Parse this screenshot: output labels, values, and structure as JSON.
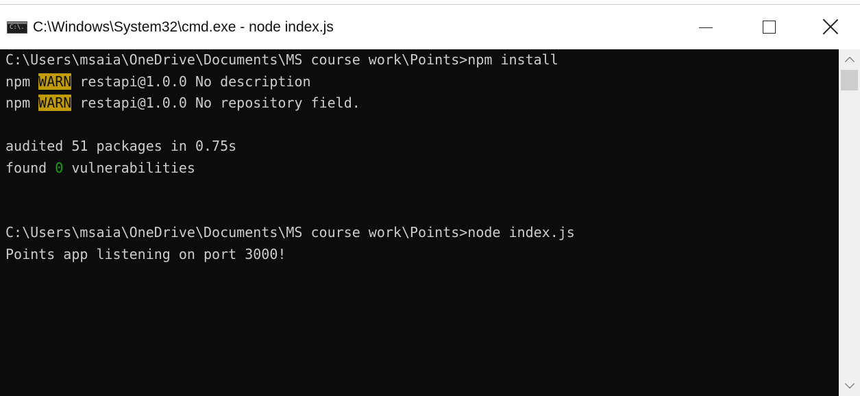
{
  "window": {
    "title": "C:\\Windows\\System32\\cmd.exe - node  index.js",
    "icon_text": "C:\\."
  },
  "controls": {
    "minimize": "minimize-icon",
    "maximize": "maximize-icon",
    "close": "close-icon"
  },
  "console": {
    "lines": [
      {
        "segments": [
          {
            "text": "C:\\Users\\msaia\\OneDrive\\Documents\\MS course work\\Points>npm install",
            "style": "normal"
          }
        ]
      },
      {
        "segments": [
          {
            "text": "npm ",
            "style": "normal"
          },
          {
            "text": "WARN",
            "style": "warn"
          },
          {
            "text": " restapi@1.0.0 No description",
            "style": "normal"
          }
        ]
      },
      {
        "segments": [
          {
            "text": "npm ",
            "style": "normal"
          },
          {
            "text": "WARN",
            "style": "warn"
          },
          {
            "text": " restapi@1.0.0 No repository field.",
            "style": "normal"
          }
        ]
      },
      {
        "segments": [
          {
            "text": "",
            "style": "normal"
          }
        ]
      },
      {
        "segments": [
          {
            "text": "audited 51 packages in 0.75s",
            "style": "normal"
          }
        ]
      },
      {
        "segments": [
          {
            "text": "found ",
            "style": "normal"
          },
          {
            "text": "0",
            "style": "zero"
          },
          {
            "text": " vulnerabilities",
            "style": "normal"
          }
        ]
      },
      {
        "segments": [
          {
            "text": "",
            "style": "normal"
          }
        ]
      },
      {
        "segments": [
          {
            "text": "",
            "style": "normal"
          }
        ]
      },
      {
        "segments": [
          {
            "text": "C:\\Users\\msaia\\OneDrive\\Documents\\MS course work\\Points>node index.js",
            "style": "normal"
          }
        ]
      },
      {
        "segments": [
          {
            "text": "Points app listening on port 3000!",
            "style": "normal"
          }
        ]
      }
    ]
  },
  "colors": {
    "console_bg": "#0c0c0c",
    "console_fg": "#cccccc",
    "warn_bg": "#c19c00",
    "success_green": "#13a10e"
  }
}
